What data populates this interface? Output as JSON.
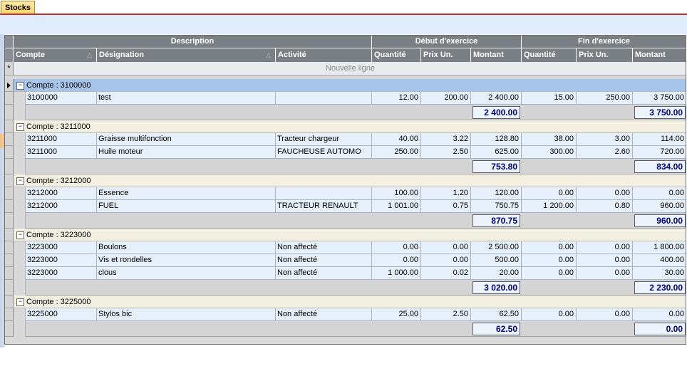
{
  "tab": {
    "label": "Stocks"
  },
  "header": {
    "group_description": "Description",
    "group_debut": "Début d'exercice",
    "group_fin": "Fin d'exercice",
    "col_compte": "Compte",
    "col_designation": "Désignation",
    "col_activite": "Activité",
    "col_quantite": "Quantité",
    "col_prix": "Prix Un.",
    "col_montant": "Montant",
    "sort_glyph": "△"
  },
  "new_row": {
    "label": "Nouvelle ligne",
    "marker": "*"
  },
  "groups": [
    {
      "label": "Compte : 3100000",
      "active": true,
      "rows": [
        {
          "compte": "3100000",
          "designation": "test",
          "activite": "",
          "q1": "12.00",
          "p1": "200.00",
          "m1": "2 400.00",
          "q2": "15.00",
          "p2": "250.00",
          "m2": "3 750.00"
        }
      ],
      "total1": "2 400.00",
      "total2": "3 750.00"
    },
    {
      "label": "Compte : 3211000",
      "active": false,
      "rows": [
        {
          "compte": "3211000",
          "designation": "Graisse multifonction",
          "activite": "Tracteur chargeur",
          "q1": "40.00",
          "p1": "3.22",
          "m1": "128.80",
          "q2": "38.00",
          "p2": "3.00",
          "m2": "114.00"
        },
        {
          "compte": "3211000",
          "designation": "Huile moteur",
          "activite": "FAUCHEUSE AUTOMO",
          "q1": "250.00",
          "p1": "2.50",
          "m1": "625.00",
          "q2": "300.00",
          "p2": "2.60",
          "m2": "720.00"
        }
      ],
      "total1": "753.80",
      "total2": "834.00"
    },
    {
      "label": "Compte : 3212000",
      "active": false,
      "rows": [
        {
          "compte": "3212000",
          "designation": "Essence",
          "activite": "",
          "q1": "100.00",
          "p1": "1.20",
          "m1": "120.00",
          "q2": "0.00",
          "p2": "0.00",
          "m2": "0.00"
        },
        {
          "compte": "3212000",
          "designation": "FUEL",
          "activite": "TRACTEUR RENAULT",
          "q1": "1 001.00",
          "p1": "0.75",
          "m1": "750.75",
          "q2": "1 200.00",
          "p2": "0.80",
          "m2": "960.00"
        }
      ],
      "total1": "870.75",
      "total2": "960.00"
    },
    {
      "label": "Compte : 3223000",
      "active": false,
      "rows": [
        {
          "compte": "3223000",
          "designation": "Boulons",
          "activite": "Non affecté",
          "q1": "0.00",
          "p1": "0.00",
          "m1": "2 500.00",
          "q2": "0.00",
          "p2": "0.00",
          "m2": "1 800.00"
        },
        {
          "compte": "3223000",
          "designation": "Vis et rondelles",
          "activite": "Non affecté",
          "q1": "0.00",
          "p1": "0.00",
          "m1": "500.00",
          "q2": "0.00",
          "p2": "0.00",
          "m2": "400.00"
        },
        {
          "compte": "3223000",
          "designation": "clous",
          "activite": "Non affecté",
          "q1": "1 000.00",
          "p1": "0.02",
          "m1": "20.00",
          "q2": "0.00",
          "p2": "0.00",
          "m2": "30.00"
        }
      ],
      "total1": "3 020.00",
      "total2": "2 230.00"
    },
    {
      "label": "Compte : 3225000",
      "active": false,
      "rows": [
        {
          "compte": "3225000",
          "designation": "Stylos bic",
          "activite": "Non affecté",
          "q1": "25.00",
          "p1": "2.50",
          "m1": "62.50",
          "q2": "0.00",
          "p2": "0.00",
          "m2": "0.00"
        }
      ],
      "total1": "62.50",
      "total2": "0.00"
    }
  ]
}
